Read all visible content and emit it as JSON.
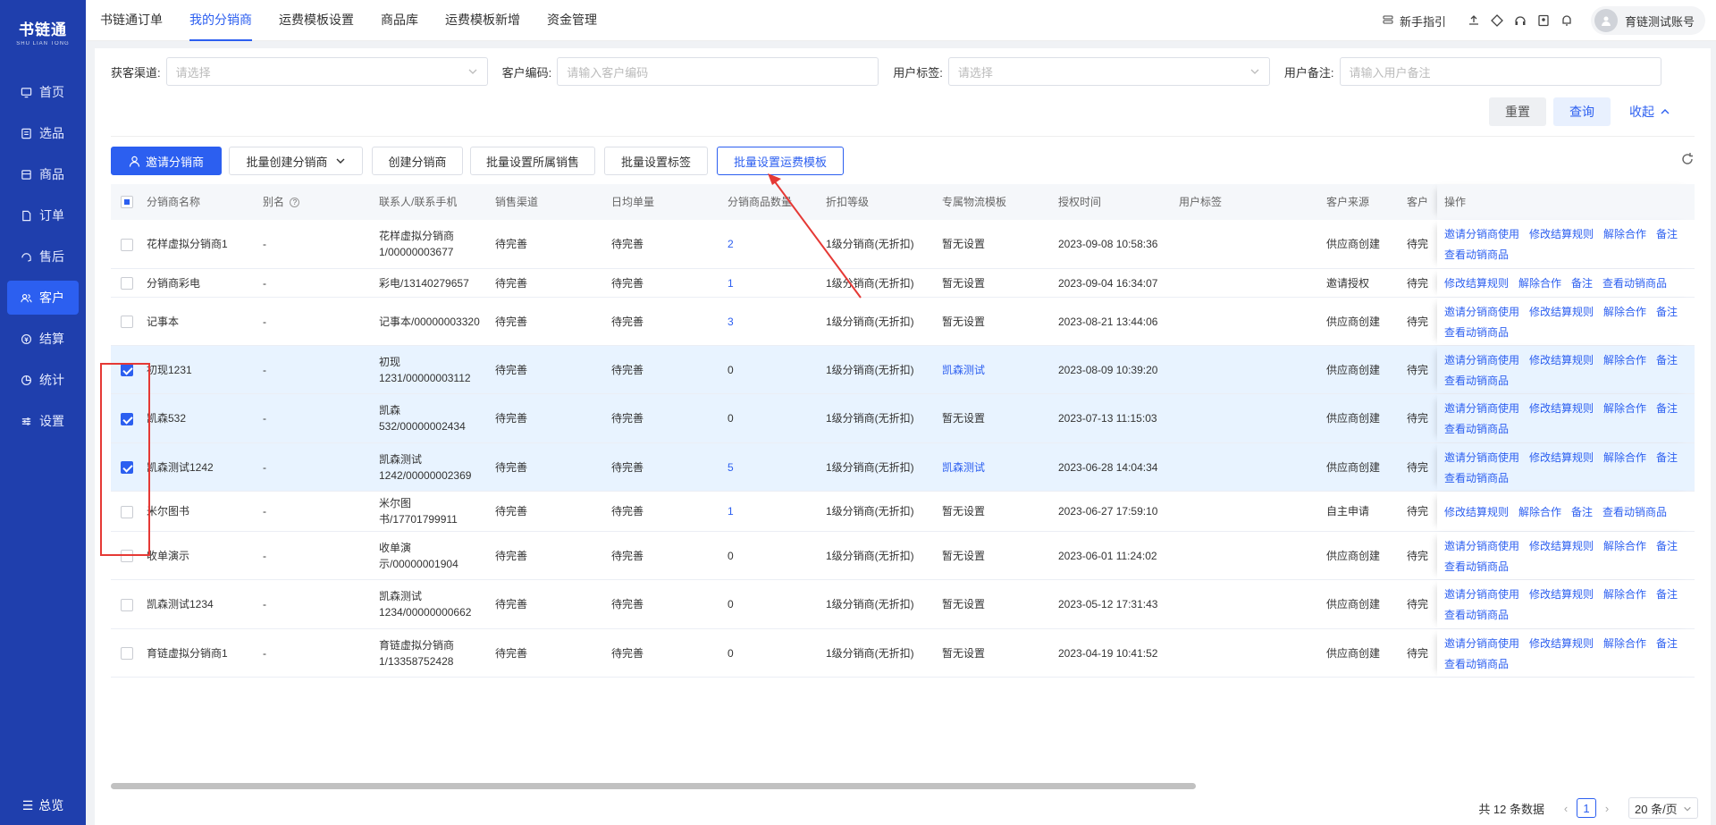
{
  "app": {
    "logo_text": "书链通",
    "logo_sub": "SHU LIAN TONG"
  },
  "sidebar": {
    "items": [
      {
        "label": "首页",
        "icon": "monitor-icon",
        "active": false
      },
      {
        "label": "选品",
        "icon": "checklist-icon",
        "active": false
      },
      {
        "label": "商品",
        "icon": "box-icon",
        "active": false
      },
      {
        "label": "订单",
        "icon": "document-icon",
        "active": false
      },
      {
        "label": "售后",
        "icon": "headset-icon",
        "active": false
      },
      {
        "label": "客户",
        "icon": "users-icon",
        "active": true
      },
      {
        "label": "结算",
        "icon": "settlement-icon",
        "active": false
      },
      {
        "label": "统计",
        "icon": "pie-chart-icon",
        "active": false
      },
      {
        "label": "设置",
        "icon": "sliders-icon",
        "active": false
      }
    ],
    "bottom_label": "总览"
  },
  "topnav": {
    "tabs": [
      {
        "label": "书链通订单",
        "active": false
      },
      {
        "label": "我的分销商",
        "active": true
      },
      {
        "label": "运费模板设置",
        "active": false
      },
      {
        "label": "商品库",
        "active": false
      },
      {
        "label": "运费模板新增",
        "active": false
      },
      {
        "label": "资金管理",
        "active": false
      }
    ],
    "guide_label": "新手指引",
    "account_name": "育链测试账号"
  },
  "filters": {
    "channel_label": "获客渠道:",
    "channel_placeholder": "请选择",
    "code_label": "客户编码:",
    "code_placeholder": "请输入客户编码",
    "tag_label": "用户标签:",
    "tag_placeholder": "请选择",
    "remark_label": "用户备注:",
    "remark_placeholder": "请输入用户备注",
    "reset_label": "重置",
    "query_label": "查询",
    "collapse_label": "收起"
  },
  "actions": {
    "invite": "邀请分销商",
    "batch_create": "批量创建分销商",
    "create": "创建分销商",
    "batch_sales": "批量设置所属销售",
    "batch_tag": "批量设置标签",
    "batch_freight": "批量设置运费模板"
  },
  "table": {
    "headers": {
      "name": "分销商名称",
      "alias": "别名",
      "contact": "联系人/联系手机",
      "channel": "销售渠道",
      "daily": "日均单量",
      "count": "分销商品数量",
      "discount": "折扣等级",
      "logistics": "专属物流模板",
      "auth_time": "授权时间",
      "user_tag": "用户标签",
      "source": "客户来源",
      "extra": "客户",
      "ops": "操作"
    },
    "rows": [
      {
        "checked": false,
        "name": "花样虚拟分销商1",
        "alias": "-",
        "contact": "花样虚拟分销商1/00000003677",
        "channel": "待完善",
        "daily": "待完善",
        "count": "2",
        "count_link": true,
        "discount": "1级分销商(无折扣)",
        "logistics": "暂无设置",
        "logistics_link": false,
        "auth_time": "2023-09-08 10:58:36",
        "source": "供应商创建",
        "extra": "待完",
        "ops": [
          "邀请分销商使用",
          "修改结算规则",
          "解除合作",
          "备注",
          "查看动销商品"
        ]
      },
      {
        "checked": false,
        "name": "分销商彩电",
        "alias": "-",
        "contact": "彩电/13140279657",
        "channel": "待完善",
        "daily": "待完善",
        "count": "1",
        "count_link": true,
        "discount": "1级分销商(无折扣)",
        "logistics": "暂无设置",
        "logistics_link": false,
        "auth_time": "2023-09-04 16:34:07",
        "source": "邀请授权",
        "extra": "待完",
        "ops": [
          "修改结算规则",
          "解除合作",
          "备注",
          "查看动销商品"
        ]
      },
      {
        "checked": false,
        "name": "记事本",
        "alias": "-",
        "contact": "记事本/00000003320",
        "channel": "待完善",
        "daily": "待完善",
        "count": "3",
        "count_link": true,
        "discount": "1级分销商(无折扣)",
        "logistics": "暂无设置",
        "logistics_link": false,
        "auth_time": "2023-08-21 13:44:06",
        "source": "供应商创建",
        "extra": "待完",
        "ops": [
          "邀请分销商使用",
          "修改结算规则",
          "解除合作",
          "备注",
          "查看动销商品"
        ]
      },
      {
        "checked": true,
        "name": "初现1231",
        "alias": "-",
        "contact": "初现1231/00000003112",
        "channel": "待完善",
        "daily": "待完善",
        "count": "0",
        "count_link": false,
        "discount": "1级分销商(无折扣)",
        "logistics": "凯森测试",
        "logistics_link": true,
        "auth_time": "2023-08-09 10:39:20",
        "source": "供应商创建",
        "extra": "待完",
        "ops": [
          "邀请分销商使用",
          "修改结算规则",
          "解除合作",
          "备注",
          "查看动销商品"
        ]
      },
      {
        "checked": true,
        "name": "凯森532",
        "alias": "-",
        "contact": "凯森532/00000002434",
        "channel": "待完善",
        "daily": "待完善",
        "count": "0",
        "count_link": false,
        "discount": "1级分销商(无折扣)",
        "logistics": "暂无设置",
        "logistics_link": false,
        "auth_time": "2023-07-13 11:15:03",
        "source": "供应商创建",
        "extra": "待完",
        "ops": [
          "邀请分销商使用",
          "修改结算规则",
          "解除合作",
          "备注",
          "查看动销商品"
        ]
      },
      {
        "checked": true,
        "name": "凯森测试1242",
        "alias": "-",
        "contact": "凯森测试1242/00000002369",
        "channel": "待完善",
        "daily": "待完善",
        "count": "5",
        "count_link": true,
        "discount": "1级分销商(无折扣)",
        "logistics": "凯森测试",
        "logistics_link": true,
        "auth_time": "2023-06-28 14:04:34",
        "source": "供应商创建",
        "extra": "待完",
        "ops": [
          "邀请分销商使用",
          "修改结算规则",
          "解除合作",
          "备注",
          "查看动销商品"
        ]
      },
      {
        "checked": false,
        "name": "米尔图书",
        "alias": "-",
        "contact": "米尔图书/17701799911",
        "channel": "待完善",
        "daily": "待完善",
        "count": "1",
        "count_link": true,
        "discount": "1级分销商(无折扣)",
        "logistics": "暂无设置",
        "logistics_link": false,
        "auth_time": "2023-06-27 17:59:10",
        "source": "自主申请",
        "extra": "待完",
        "ops": [
          "修改结算规则",
          "解除合作",
          "备注",
          "查看动销商品"
        ]
      },
      {
        "checked": false,
        "name": "收单演示",
        "alias": "-",
        "contact": "收单演示/00000001904",
        "channel": "待完善",
        "daily": "待完善",
        "count": "0",
        "count_link": false,
        "discount": "1级分销商(无折扣)",
        "logistics": "暂无设置",
        "logistics_link": false,
        "auth_time": "2023-06-01 11:24:02",
        "source": "供应商创建",
        "extra": "待完",
        "ops": [
          "邀请分销商使用",
          "修改结算规则",
          "解除合作",
          "备注",
          "查看动销商品"
        ]
      },
      {
        "checked": false,
        "name": "凯森测试1234",
        "alias": "-",
        "contact": "凯森测试1234/00000000662",
        "channel": "待完善",
        "daily": "待完善",
        "count": "0",
        "count_link": false,
        "discount": "1级分销商(无折扣)",
        "logistics": "暂无设置",
        "logistics_link": false,
        "auth_time": "2023-05-12 17:31:43",
        "source": "供应商创建",
        "extra": "待完",
        "ops": [
          "邀请分销商使用",
          "修改结算规则",
          "解除合作",
          "备注",
          "查看动销商品"
        ]
      },
      {
        "checked": false,
        "name": "育链虚拟分销商1",
        "alias": "-",
        "contact": "育链虚拟分销商1/13358752428",
        "channel": "待完善",
        "daily": "待完善",
        "count": "0",
        "count_link": false,
        "discount": "1级分销商(无折扣)",
        "logistics": "暂无设置",
        "logistics_link": false,
        "auth_time": "2023-04-19 10:41:52",
        "source": "供应商创建",
        "extra": "待完",
        "ops": [
          "邀请分销商使用",
          "修改结算规则",
          "解除合作",
          "备注",
          "查看动销商品"
        ]
      }
    ]
  },
  "pagination": {
    "total": "共 12 条数据",
    "current": "1",
    "page_size": "20 条/页"
  }
}
